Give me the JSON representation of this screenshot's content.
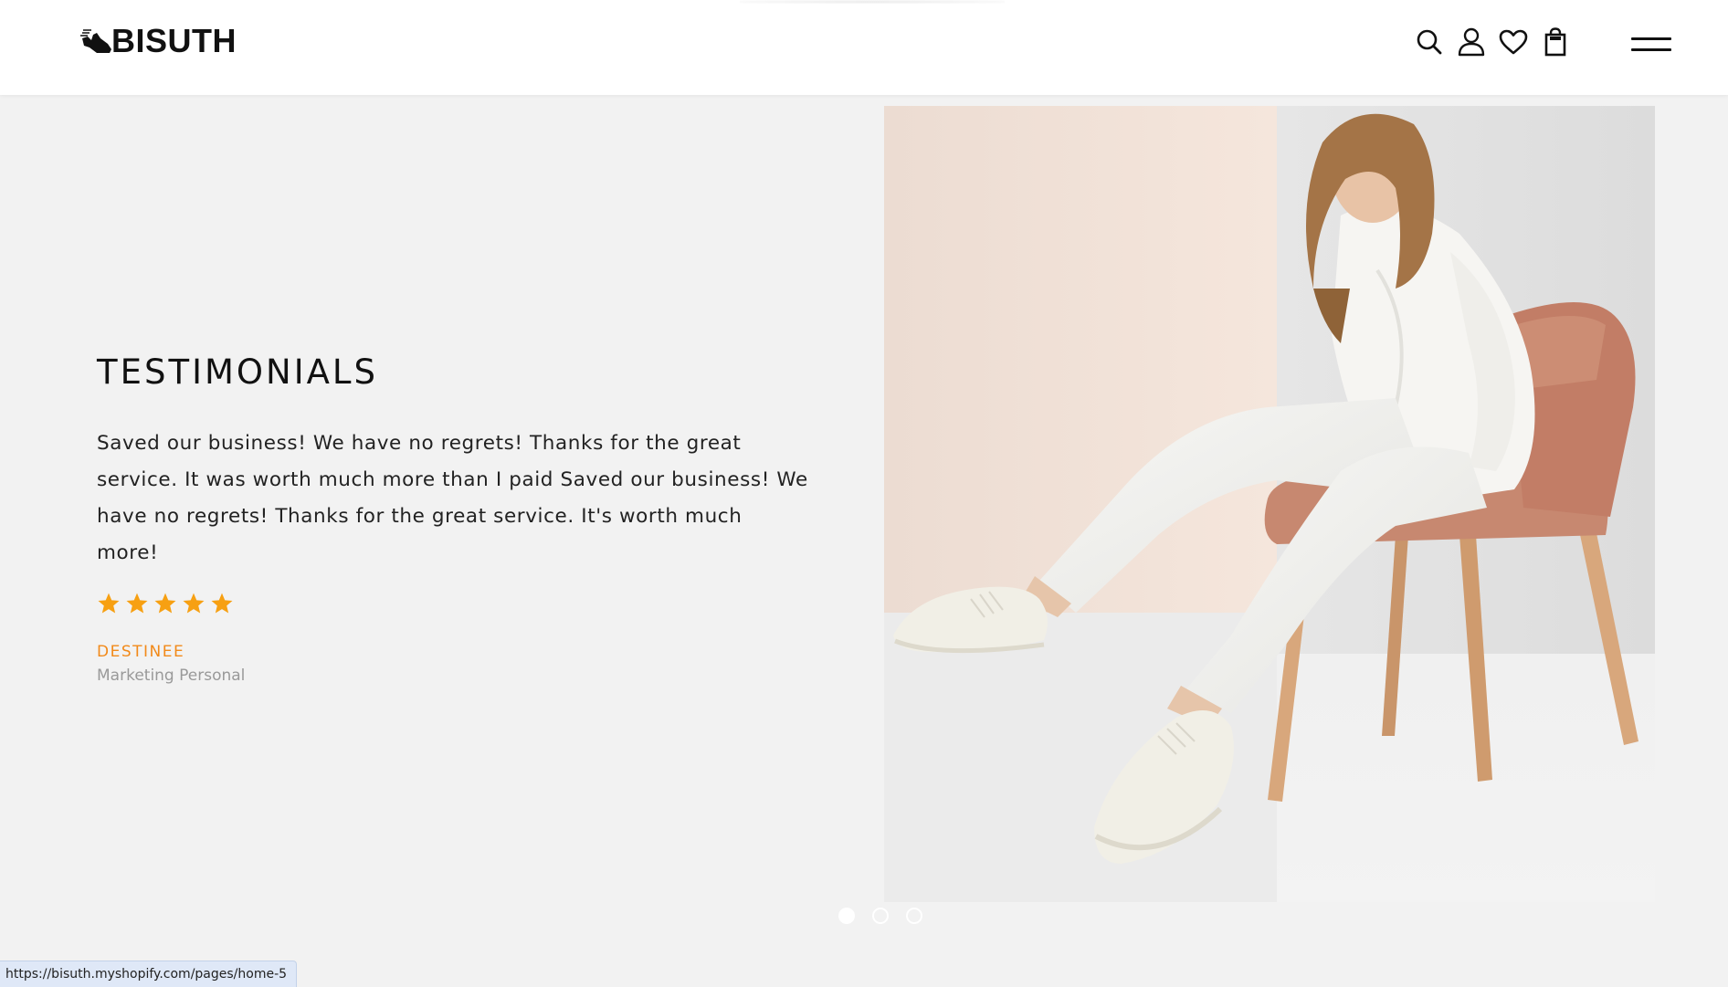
{
  "header": {
    "logo_text": "BISUTH",
    "icons": {
      "search": "search-icon",
      "account": "user-icon",
      "wishlist": "heart-icon",
      "cart": "shopping-bag-icon",
      "menu": "hamburger-menu-icon"
    }
  },
  "testimonial": {
    "section_title": "TESTIMONIALS",
    "quote": "Saved our business! We have no regrets! Thanks for the great service. It was worth much more than I paid Saved our business! We have no regrets! Thanks for the great service. It's worth much more!",
    "rating": 5,
    "rating_max": 5,
    "author_name": "DESTINEE",
    "author_role": "Marketing Personal"
  },
  "slider": {
    "total_slides": 3,
    "active_slide": 1
  },
  "status_bar": {
    "url": "https://bisuth.myshopify.com/pages/home-5"
  },
  "colors": {
    "page_background": "#f2f2f2",
    "header_background": "#ffffff",
    "accent_orange": "#f28a1a",
    "star_color": "#f7a012",
    "text_primary": "#111111",
    "text_muted": "#999999",
    "status_bar_background": "#dfe8f7"
  }
}
